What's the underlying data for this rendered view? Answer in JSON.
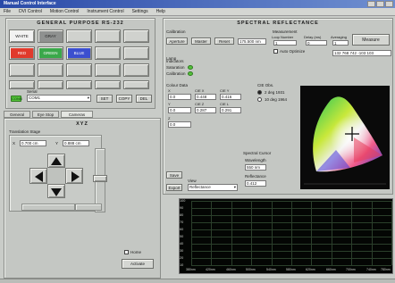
{
  "window": {
    "title": "Manual Control Interface"
  },
  "menu": [
    "File",
    "DVI Control",
    "Motion Control",
    "Instrument Control",
    "Settings",
    "Help"
  ],
  "rs232": {
    "title": "GENERAL PURPOSE RS-232",
    "buttons": [
      {
        "label": "WHITE",
        "color": "#f2f2f2",
        "text": "#222"
      },
      {
        "label": "GRAY",
        "color": "#8f9190",
        "text": "#222"
      },
      {
        "label": "RED",
        "color": "#e03a2c",
        "text": "#fff"
      },
      {
        "label": "GREEN",
        "color": "#3aa84a",
        "text": "#fff"
      },
      {
        "label": "BLUE",
        "color": "#3b4fcf",
        "text": "#fff"
      }
    ],
    "status_label": "CONN",
    "port_label": "Serial",
    "port_value": "COM1",
    "btn_set": "SET",
    "btn_copy": "COPY",
    "btn_del": "DEL"
  },
  "tabs": [
    "General",
    "Eye Stop",
    "Cameras Settings"
  ],
  "xyz": {
    "title": "XYZ",
    "stage_label": "Translation Stage",
    "x_label": "X",
    "x_value": "0.700 cm",
    "y_label": "Y",
    "y_value": "0.888 cm",
    "home_label": "Home",
    "activate_label": "Activate"
  },
  "spectral": {
    "title": "SPECTRAL REFLECTANCE",
    "calibration_label": "Calibration",
    "cal_buttons": [
      "Aperture",
      "Master",
      "Reset"
    ],
    "meas_label": "Measurement",
    "measure_button": "Measure",
    "loop_label": "Loop Number",
    "delay_label": "Delay (ms)",
    "averaging_label": "Averaging",
    "loop_value": "1",
    "delay_value": "0",
    "avg_value": "1",
    "auto_label": "Auto Optimize",
    "integration_value": "175.500 nm",
    "result_value": "132 768 742 -103 103",
    "lamp_label": "Lamp",
    "status_label": "Indicators",
    "saturation_label": "Saturation",
    "calibration_ok_label": "Calibration",
    "color_data_label": "Colour Data",
    "cie_labels": [
      "X",
      "CIE X",
      "CIE Y",
      "Y",
      "CIE Z",
      "CIE L",
      "Z"
    ],
    "cie_values": [
      "0.0",
      "0.448",
      "0.416",
      "0.0",
      "0.287",
      "0.291",
      "0.0"
    ],
    "observer_label": "CIE Obs.",
    "observer_2": "2 deg 1931",
    "observer_10": "10 deg 1964",
    "save_label": "Save",
    "export_label": "Export",
    "view_label": "View",
    "view_value": "Reflectance",
    "spectral_cursor_label": "Spectral Cursor",
    "wavelength_label": "Wavelength",
    "wavelength_value": "550 nm",
    "reflectance_label": "Reflectance",
    "reflectance_value": "0.412"
  },
  "spectrum_chart": {
    "y_ticks": [
      "100",
      "90",
      "80",
      "70",
      "60",
      "50",
      "40",
      "30",
      "20",
      "10"
    ],
    "x_ticks": [
      "380nm",
      "420nm",
      "460nm",
      "500nm",
      "540nm",
      "580nm",
      "620nm",
      "660nm",
      "700nm",
      "740nm",
      "780nm"
    ]
  }
}
